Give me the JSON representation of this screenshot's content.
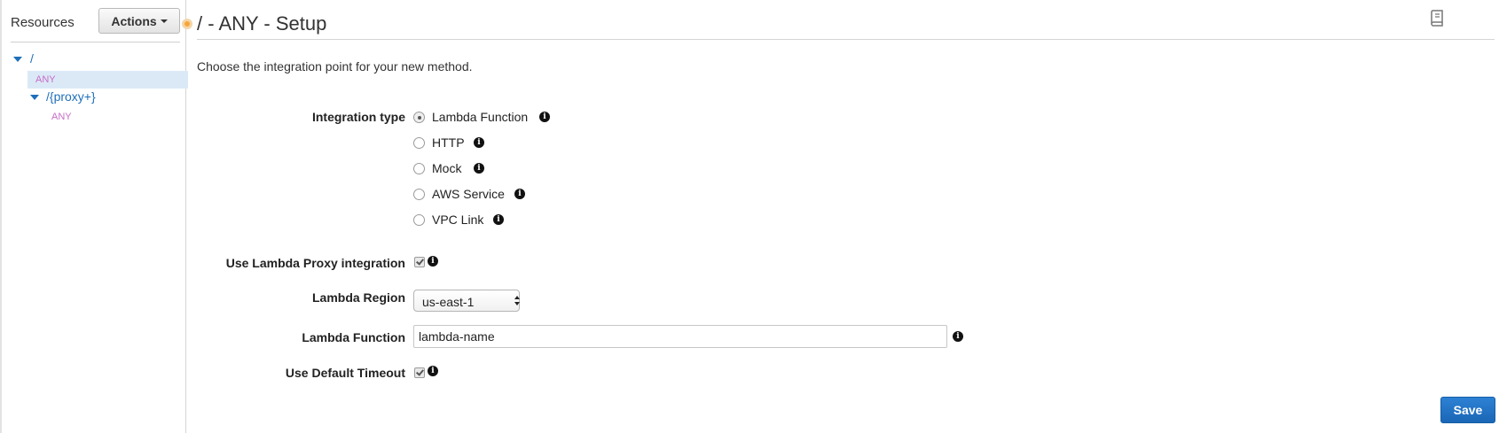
{
  "sidebar": {
    "title": "Resources",
    "actions_label": "Actions",
    "tree": {
      "root": {
        "label": "/",
        "method": "ANY"
      },
      "proxy": {
        "label": "/{proxy+}",
        "method": "ANY"
      }
    }
  },
  "main": {
    "title": "/ - ANY - Setup",
    "intro": "Choose the integration point for your new method.",
    "integration_type": {
      "label": "Integration type",
      "options": [
        "Lambda Function",
        "HTTP",
        "Mock",
        "AWS Service",
        "VPC Link"
      ],
      "selected": "Lambda Function"
    },
    "proxy_integration": {
      "label": "Use Lambda Proxy integration",
      "checked": true
    },
    "region": {
      "label": "Lambda Region",
      "value": "us-east-1"
    },
    "function": {
      "label": "Lambda Function",
      "value": "lambda-name"
    },
    "timeout": {
      "label": "Use Default Timeout",
      "checked": true
    },
    "save_label": "Save"
  },
  "icons": {
    "info": "info-icon",
    "doc": "book-icon",
    "info_glyph": "i"
  },
  "colors": {
    "link": "#1e6fb9",
    "method": "#c86cc9",
    "selected_row": "#dbe9f7",
    "primary_button": "#1b66b6"
  }
}
